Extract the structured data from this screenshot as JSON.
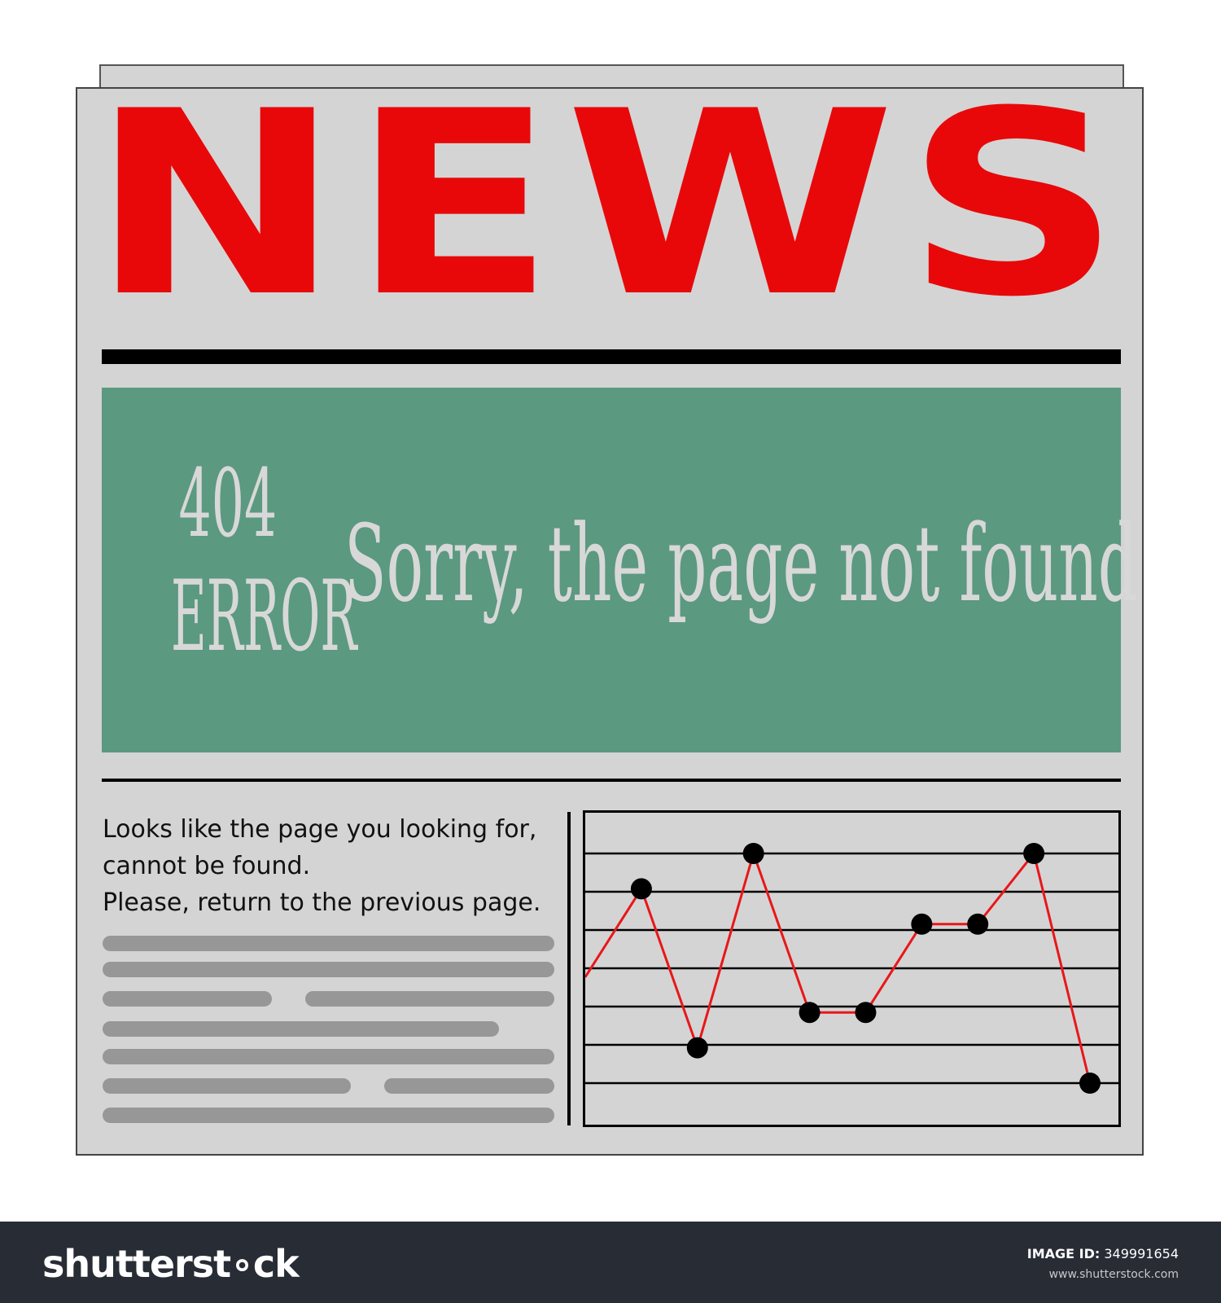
{
  "masthead": "NEWS",
  "banner": {
    "code": "404",
    "word": "ERROR",
    "headline": "Sorry, the page not found",
    "background_color": "#5b9980"
  },
  "article": {
    "lines": [
      "Looks like the page you looking for,",
      "cannot be found.",
      "Please, return to the previous page."
    ],
    "placeholder_line_color": "#979797"
  },
  "chart_data": {
    "type": "line",
    "x": [
      0,
      1,
      2,
      3,
      4,
      5,
      6,
      7,
      8,
      9,
      10
    ],
    "y": [
      4,
      6.5,
      2,
      7.5,
      3,
      3,
      5.5,
      5.5,
      7.5,
      1,
      null
    ],
    "points": [
      {
        "x": 1,
        "y": 6.5
      },
      {
        "x": 2,
        "y": 2
      },
      {
        "x": 3,
        "y": 7.5
      },
      {
        "x": 4,
        "y": 3
      },
      {
        "x": 5,
        "y": 3
      },
      {
        "x": 6,
        "y": 5.5
      },
      {
        "x": 7,
        "y": 5.5
      },
      {
        "x": 8,
        "y": 7.5
      },
      {
        "x": 9,
        "y": 1
      }
    ],
    "ylim": [
      0,
      8
    ],
    "grid": true,
    "line_color": "#e8171a",
    "marker_color": "#000000"
  },
  "footer": {
    "brand": "shutterst∘ck",
    "image_id_label": "IMAGE ID:",
    "image_id": "349991654",
    "site": "www.shutterstock.com"
  },
  "colors": {
    "masthead": "#e8080a",
    "paper": "#d4d4d4",
    "footer": "#272c35"
  }
}
